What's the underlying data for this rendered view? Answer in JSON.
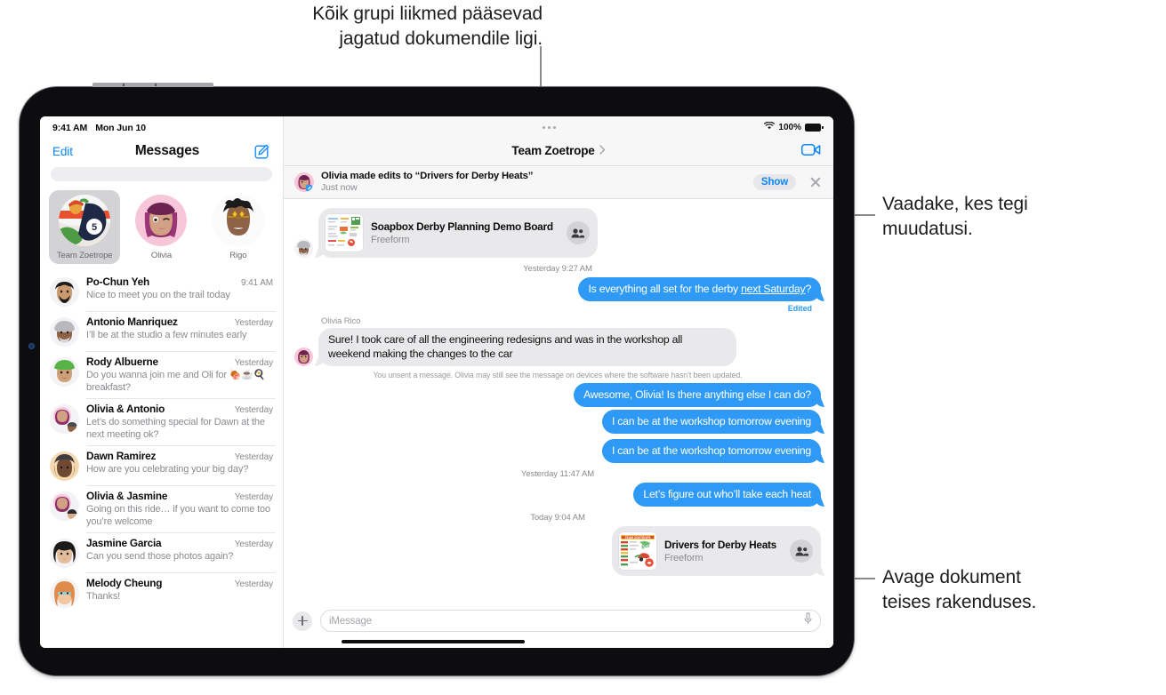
{
  "callouts": {
    "top": "Kõik grupi liikmed pääsevad\njagatud dokumendile ligi.",
    "right_top": "Vaadake, kes tegi\nmuudatusi.",
    "right_bottom": "Avage dokument\nteises rakenduses."
  },
  "sidebar": {
    "status": {
      "time": "9:41 AM",
      "date": "Mon Jun 10"
    },
    "nav": {
      "edit_label": "Edit",
      "title": "Messages",
      "compose_icon": "compose-icon"
    },
    "search_placeholder": "",
    "pinned": [
      {
        "name": "Team Zoetrope",
        "selected": true,
        "badge": "5"
      },
      {
        "name": "Olivia",
        "selected": false
      },
      {
        "name": "Rigo",
        "selected": false
      }
    ],
    "conversations": [
      {
        "name": "Po-Chun Yeh",
        "time": "9:41 AM",
        "preview": "Nice to meet you on the trail today"
      },
      {
        "name": "Antonio Manriquez",
        "time": "Yesterday",
        "preview": "I’ll be at the studio a few minutes early"
      },
      {
        "name": "Rody Albuerne",
        "time": "Yesterday",
        "preview": "Do you wanna join me and Oli for 🍖☕🍳 breakfast?"
      },
      {
        "name": "Olivia & Antonio",
        "time": "Yesterday",
        "preview": "Let’s do something special for Dawn at the next meeting ok?"
      },
      {
        "name": "Dawn Ramirez",
        "time": "Yesterday",
        "preview": "How are you celebrating your big day?"
      },
      {
        "name": "Olivia & Jasmine",
        "time": "Yesterday",
        "preview": "Going on this ride… if you want to come too you’re welcome"
      },
      {
        "name": "Jasmine Garcia",
        "time": "Yesterday",
        "preview": "Can you send those photos again?"
      },
      {
        "name": "Melody Cheung",
        "time": "Yesterday",
        "preview": "Thanks!"
      }
    ]
  },
  "chat": {
    "status": {
      "wifi_icon": "wifi-icon",
      "battery_percent": "100%"
    },
    "header": {
      "title": "Team Zoetrope",
      "chevron_icon": "chevron-right-icon",
      "facetime_icon": "facetime-video-icon"
    },
    "banner": {
      "title": "Olivia made edits to “Drivers for Derby Heats”",
      "subtitle": "Just now",
      "show_label": "Show",
      "close_icon": "close-icon"
    },
    "timeline": [
      {
        "kind": "doc",
        "side": "in",
        "title": "Soapbox Derby Planning Demo Board",
        "app": "Freeform",
        "people_icon": "people-shared-icon"
      },
      {
        "kind": "timestamp",
        "text": "Yesterday 9:27 AM"
      },
      {
        "kind": "bubble",
        "side": "out",
        "text": "Is everything all set for the derby ",
        "underlined": "next Saturday",
        "text_tail": "?",
        "edited_label": "Edited"
      },
      {
        "kind": "sender",
        "text": "Olivia Rico"
      },
      {
        "kind": "bubble",
        "side": "in",
        "text": "Sure! I took care of all the engineering redesigns and was in the workshop all weekend making the changes to the car"
      },
      {
        "kind": "system",
        "text": "You unsent a message. Olivia may still see the message on devices where the software hasn’t been updated."
      },
      {
        "kind": "bubble",
        "side": "out",
        "text": "Awesome, Olivia! Is there anything else I can do?"
      },
      {
        "kind": "bubble",
        "side": "out",
        "text": "I can be at the workshop tomorrow evening"
      },
      {
        "kind": "bubble",
        "side": "out",
        "text": "I can be at the workshop tomorrow evening"
      },
      {
        "kind": "timestamp",
        "text": "Yesterday 11:47 AM"
      },
      {
        "kind": "bubble",
        "side": "out",
        "text": "Let’s figure out who’ll take each heat"
      },
      {
        "kind": "timestamp",
        "text": "Today 9:04 AM"
      },
      {
        "kind": "doc",
        "side": "out",
        "title": "Drivers for Derby Heats",
        "app": "Freeform",
        "people_icon": "people-shared-icon"
      }
    ],
    "composer": {
      "plus_icon": "plus-icon",
      "placeholder": "iMessage",
      "mic_icon": "microphone-icon"
    }
  },
  "colors": {
    "accent_blue": "#0b84ff",
    "bubble_blue": "#2f9af5",
    "bubble_gray": "#e9e9eb",
    "chrome_gray": "#f7f7f8"
  }
}
